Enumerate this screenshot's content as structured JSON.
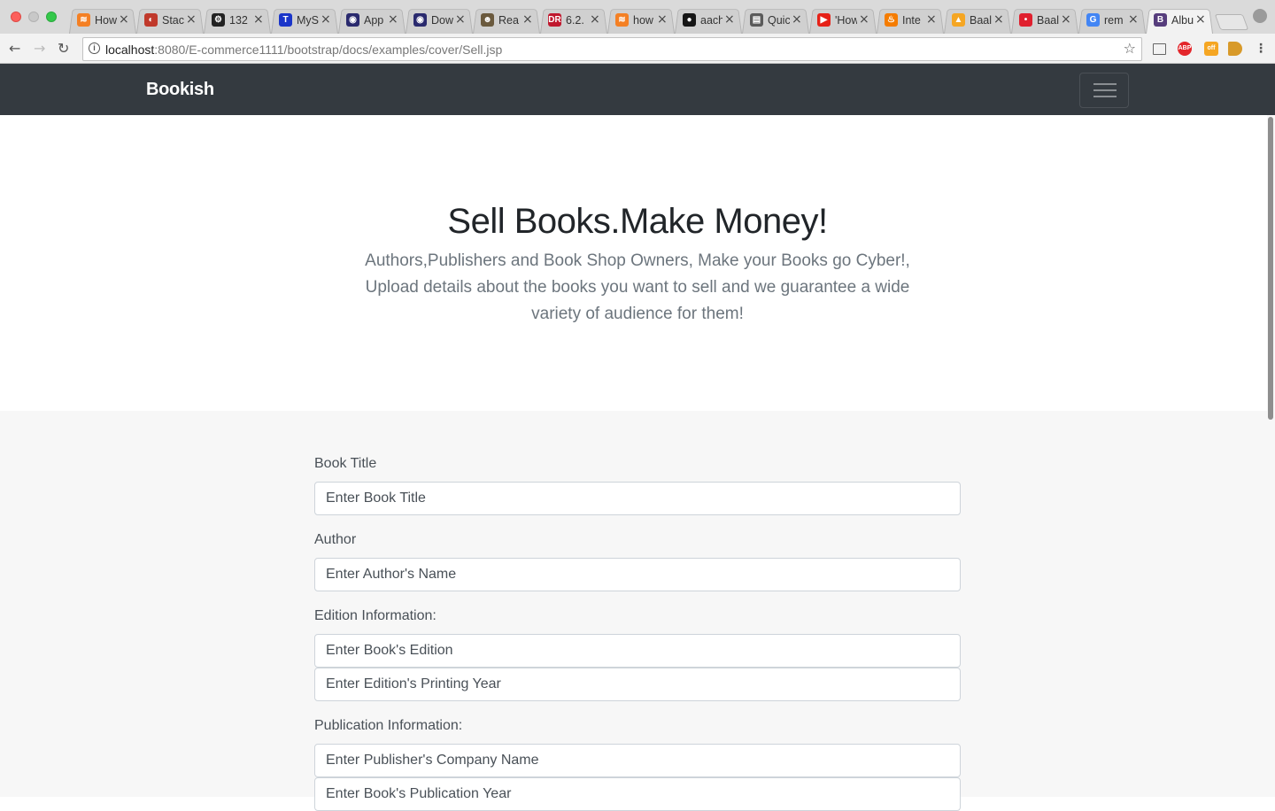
{
  "browser": {
    "tabs": [
      {
        "title": "How to",
        "icon": "stackoverflow-icon",
        "color": "#f48024",
        "glyph": "≋"
      },
      {
        "title": "Stack",
        "icon": "stackexchange-icon",
        "color": "#c0392b",
        "glyph": "◐"
      },
      {
        "title": "132",
        "icon": "settings-icon",
        "color": "#222222",
        "glyph": "⚙"
      },
      {
        "title": "MySQL",
        "icon": "t-icon",
        "color": "#1a35c9",
        "glyph": "T"
      },
      {
        "title": "App",
        "icon": "eye-icon",
        "color": "#2a2a6e",
        "glyph": "◉"
      },
      {
        "title": "Dow",
        "icon": "eye-icon",
        "color": "#2a2a6e",
        "glyph": "◉"
      },
      {
        "title": "Rea",
        "icon": "avatar-icon",
        "color": "#6b5a3e",
        "glyph": "☻"
      },
      {
        "title": "6.2.",
        "icon": "dr-icon",
        "color": "#c0182e",
        "glyph": "DR"
      },
      {
        "title": "how",
        "icon": "stackoverflow-icon",
        "color": "#f48024",
        "glyph": "≋"
      },
      {
        "title": "aach",
        "icon": "github-icon",
        "color": "#161616",
        "glyph": "●"
      },
      {
        "title": "Quic",
        "icon": "document-icon",
        "color": "#5a5a5a",
        "glyph": "▤"
      },
      {
        "title": "'How",
        "icon": "youtube-icon",
        "color": "#e62117",
        "glyph": "▶"
      },
      {
        "title": "Inte",
        "icon": "flame-icon",
        "color": "#f57c00",
        "glyph": "♨"
      },
      {
        "title": "Baal",
        "icon": "baeldung-icon",
        "color": "#f5a623",
        "glyph": "▲"
      },
      {
        "title": "Baal",
        "icon": "dots-icon",
        "color": "#e0202e",
        "glyph": "•"
      },
      {
        "title": "rem",
        "icon": "google-icon",
        "color": "#4285f4",
        "glyph": "G"
      },
      {
        "title": "Albu",
        "icon": "bootstrap-icon",
        "color": "#563d7c",
        "glyph": "B",
        "active": true
      }
    ],
    "url_host": "localhost",
    "url_rest": ":8080/E-commerce1111/bootstrap/docs/examples/cover/Sell.jsp"
  },
  "navbar": {
    "brand": "Bookish"
  },
  "hero": {
    "title": "Sell Books.Make Money!",
    "lead": "Authors,Publishers and Book Shop Owners, Make your Books go Cyber!, Upload details about the books you want to sell and we guarantee a wide variety of audience for them!"
  },
  "form": {
    "book_title_label": "Book Title",
    "book_title_placeholder": "Enter Book Title",
    "author_label": "Author",
    "author_placeholder": "Enter Author's Name",
    "edition_label": "Edition Information:",
    "edition_placeholder": "Enter Book's Edition",
    "printing_year_placeholder": "Enter Edition's Printing Year",
    "publication_label": "Publication Information:",
    "publisher_placeholder": "Enter Publisher's Company Name",
    "publication_year_placeholder": "Enter Book's Publication Year"
  },
  "colors": {
    "navbar_bg": "#343a40",
    "form_bg": "#f7f7f7",
    "text_muted": "#6c757d"
  }
}
